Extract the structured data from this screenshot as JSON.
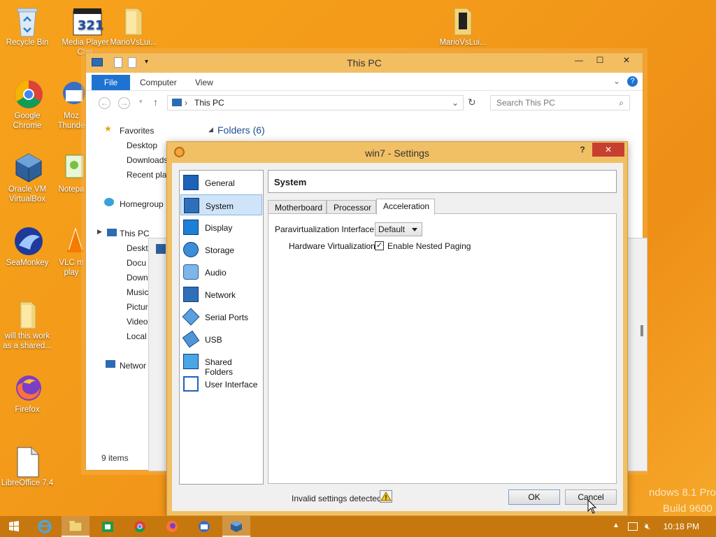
{
  "desktop": {
    "icons": [
      {
        "label": "Recycle Bin"
      },
      {
        "label": "Media Player Clas"
      },
      {
        "label": "MarioVsLui..."
      },
      {
        "label": "MarioVsLui..."
      },
      {
        "label": "Google Chrome"
      },
      {
        "label": "Moz Thunde"
      },
      {
        "label": "Oracle VM VirtualBox"
      },
      {
        "label": "Notepa"
      },
      {
        "label": "SeaMonkey"
      },
      {
        "label": "VLC m play"
      },
      {
        "label": "will this work as a shared..."
      },
      {
        "label": "Firefox"
      },
      {
        "label": "LibreOffice 7.4"
      }
    ],
    "watermark_line1": "ndows 8.1 Pro",
    "watermark_line2": "Build 9600"
  },
  "explorer": {
    "title": "This PC",
    "ribbon_tabs": [
      "File",
      "Computer",
      "View"
    ],
    "address": "This PC",
    "search_placeholder": "Search This PC",
    "folders_header": "Folders (6)",
    "nav": {
      "favorites": "Favorites",
      "fav_items": [
        "Desktop",
        "Downloads",
        "Recent plac"
      ],
      "homegroup": "Homegroup",
      "this_pc": "This PC",
      "pc_items": [
        "Deskt",
        "Docu",
        "Down",
        "Music",
        "Pictur",
        "Video",
        "Local"
      ],
      "network": "Networ"
    },
    "status": "9 items"
  },
  "dialog": {
    "title": "win7 - Settings",
    "help": "?",
    "close": "✕",
    "categories": [
      {
        "name": "General",
        "icon": "general-icon"
      },
      {
        "name": "System",
        "icon": "system-icon"
      },
      {
        "name": "Display",
        "icon": "display-icon"
      },
      {
        "name": "Storage",
        "icon": "storage-icon"
      },
      {
        "name": "Audio",
        "icon": "audio-icon"
      },
      {
        "name": "Network",
        "icon": "network-icon"
      },
      {
        "name": "Serial Ports",
        "icon": "serial-ports-icon"
      },
      {
        "name": "USB",
        "icon": "usb-icon"
      },
      {
        "name": "Shared Folders",
        "icon": "shared-folders-icon"
      },
      {
        "name": "User Interface",
        "icon": "user-interface-icon"
      }
    ],
    "selected_category": "System",
    "page_title": "System",
    "tabs": [
      "Motherboard",
      "Processor",
      "Acceleration"
    ],
    "active_tab": "Acceleration",
    "paravirt_label": "Paravirtualization Interface:",
    "paravirt_value": "Default",
    "hwvirt_label": "Hardware Virtualization:",
    "nested_paging_label": "Enable Nested Paging",
    "nested_paging_checked": true,
    "invalid_settings": "Invalid settings detected",
    "ok": "OK",
    "cancel": "Cancel"
  },
  "taskbar": {
    "clock": "10:18 PM",
    "accent": "#c6780f"
  }
}
